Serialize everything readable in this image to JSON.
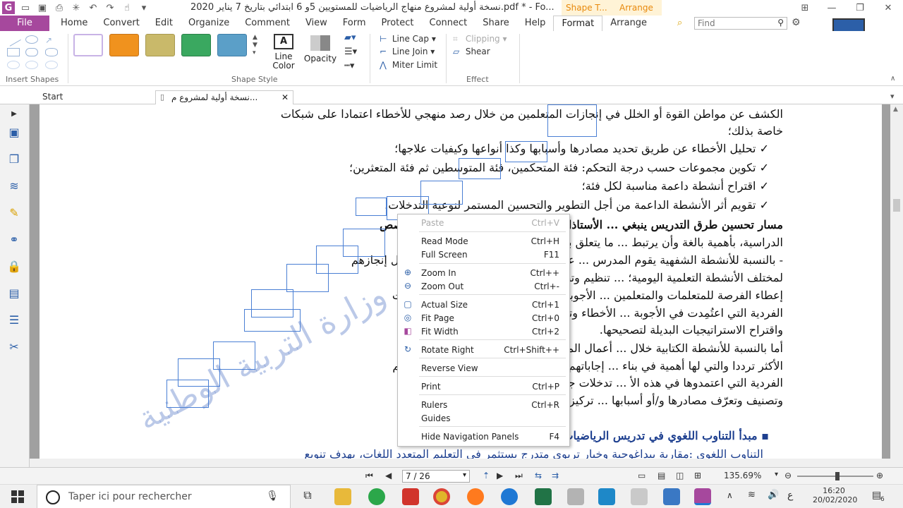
{
  "titlebar": {
    "title": "نسخة أولية لمشروع منهاج الرياضيات للمستويين 5و 6 ابتدائي بتاريخ 7 يناير 2020.pdf * - Fo...",
    "context_tab_shape": "Shape T...",
    "context_tab_arrange": "Arrange"
  },
  "ribbon_tabs": [
    "File",
    "Home",
    "Convert",
    "Edit",
    "Organize",
    "Comment",
    "View",
    "Form",
    "Protect",
    "Connect",
    "Share",
    "Help",
    "Format",
    "Arrange"
  ],
  "active_tab": "Format",
  "find": {
    "placeholder": "Find"
  },
  "ribbon": {
    "insert_shapes_label": "Insert Shapes",
    "shape_style_label": "Shape Style",
    "effect_label": "Effect",
    "line_color_label": "Line Color",
    "opacity_label": "Opacity",
    "line_cap": "Line Cap",
    "line_join": "Line Join",
    "miter_limit": "Miter Limit",
    "clipping": "Clipping",
    "shear": "Shear",
    "swatches": [
      "#ffffff",
      "#f0921e",
      "#c9b96a",
      "#3aa860",
      "#5b9fc8"
    ]
  },
  "doc_tabs": {
    "start": "Start",
    "doc": "نسخة أولية لمشروع م..."
  },
  "document": {
    "lines": [
      "الكشف عن مواطن القوة أو الخلل في إنجازات المتعلمين من خلال رصد منهجي للأخطاء اعتمادا على شبكات",
      "خاصة بذلك؛",
      "✓  تحليل الأخطاء عن طريق تحديد مصادرها وأسبابها وكذا أنواعها وكيفيات علاجها؛",
      "✓  تكوين مجموعات حسب درجة التحكم: فئة المتحكمين، فئة المتوسطين ثم فئة المتعثرين؛",
      "✓  اقتراح أنشطة داعمة مناسبة لكل فئة؛",
      "✓  تقويم أثر الأنشطة الداعمة من أجل التطوير والتحسين المستمر لنوعية التدخلات.",
      "مسار تحسين طرق التدريس ينبغي ... الأستاذات والتلاميذ خلال تخطيط وإنجاز الحصص",
      "الدراسية، بأهمية بالغة وأن يرتبط ... ما يتعلق بالأنشطة الشفهية أو الأنشطة الكتابية:",
      "- بالنسبة للأنشطة الشفهية يقوم المدرس ... عليها المتعلمون والمتعلمات شفهيا خلال إنجازهم",
      "لمختلف الأنشطة التعلمية اليومية؛ ... تنظيم وتطوير أنشطة التعلم، مع الحرص على",
      "إعطاء الفرصة للمتعلمات والمتعلمين ... الأجوبة، والتركيز على مناقشة الاستراتيجيات",
      "الفردية التي اعتُمِدت في الأجوبة ... الأخطاء وتعرف أنواعها وتصنيفها، جماعيا،",
      "واقتراح الاستراتيجيات البديلة لتصحيحها.",
      "أما بالنسبة للأنشطة الكتابية خلال ... أعمال المتعلمات والمتعلمين، ويرصد الأخطاء",
      "الأكثر ترددا والتي لها أهمية في بناء ... إجاباتهم، مع التركيز على توضيح استراتيجياتهم",
      "الفردية التي اعتمدوها في هذه الأ ... تدخلات جماعيا، للوصول إلى تحديد الأخطاء",
      "وتصنيف وتعرّف مصادرها و/أو أسبابها ... تركيز أكثر خلال مرحلة التقويم والدعم.",
      "▪  مبدأ التناوب اللغوي في تدريس الرياضيات",
      "التناوب اللغوي :مقاربة بيداغوجية وخيار تربوي متدرج يستثمر في التعليم المتعدد اللغات، بهدف تنويع"
    ],
    "watermark": "وزارة التربية الوطنية"
  },
  "context_menu": [
    {
      "label": "Paste",
      "shortcut": "Ctrl+V",
      "disabled": true,
      "icon": ""
    },
    {
      "label": "Read Mode",
      "shortcut": "Ctrl+H",
      "icon": ""
    },
    {
      "label": "Full Screen",
      "shortcut": "F11",
      "icon": ""
    },
    {
      "label": "Zoom In",
      "shortcut": "Ctrl++",
      "icon": "zoom-in-icon"
    },
    {
      "label": "Zoom Out",
      "shortcut": "Ctrl+-",
      "icon": "zoom-out-icon"
    },
    {
      "label": "Actual Size",
      "shortcut": "Ctrl+1",
      "icon": "actual-size-icon"
    },
    {
      "label": "Fit Page",
      "shortcut": "Ctrl+0",
      "icon": "fit-page-icon"
    },
    {
      "label": "Fit Width",
      "shortcut": "Ctrl+2",
      "icon": "fit-width-icon"
    },
    {
      "label": "Rotate Right",
      "shortcut": "Ctrl+Shift++",
      "icon": "rotate-right-icon"
    },
    {
      "label": "Reverse View",
      "shortcut": "",
      "icon": ""
    },
    {
      "label": "Print",
      "shortcut": "Ctrl+P",
      "icon": ""
    },
    {
      "label": "Rulers",
      "shortcut": "Ctrl+R",
      "icon": ""
    },
    {
      "label": "Guides",
      "shortcut": "",
      "icon": ""
    },
    {
      "label": "Hide Navigation Panels",
      "shortcut": "F4",
      "icon": ""
    }
  ],
  "statusbar": {
    "page": "7 / 26",
    "zoom": "135.69%"
  },
  "taskbar": {
    "search_placeholder": "Taper ici pour rechercher",
    "time": "16:20",
    "date": "20/02/2020",
    "lang": "ع",
    "notifications": "6"
  }
}
